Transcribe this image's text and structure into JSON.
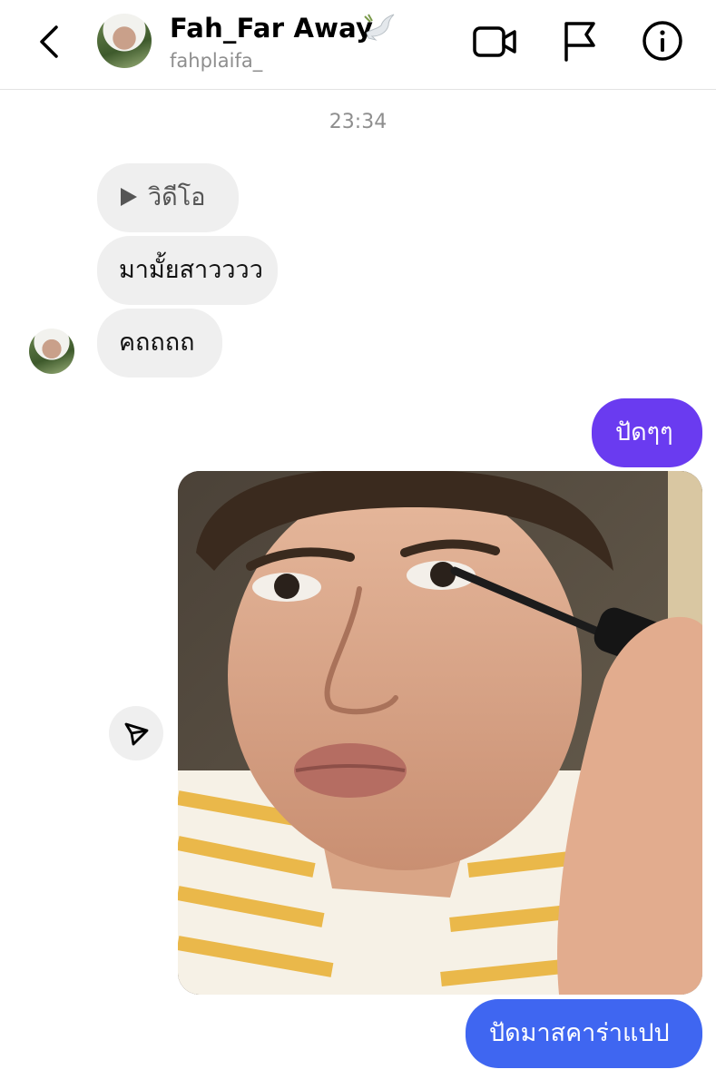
{
  "header": {
    "name": "Fah_Far Away",
    "username": "fahplaifa_"
  },
  "thread": {
    "timestamp": "23:34",
    "incoming": {
      "video_label": "วิดีโอ",
      "message_2": "มามั้ยสาวววว",
      "message_3": "คถถถถ"
    },
    "outgoing": {
      "message_1": "ปัดๆๆ",
      "message_2": "ปัดมาสคาร่าแปป"
    }
  },
  "colors": {
    "outgoing_purple": "#6a3bf0",
    "outgoing_blue": "#3f66f1",
    "incoming_bg": "#efefef"
  }
}
